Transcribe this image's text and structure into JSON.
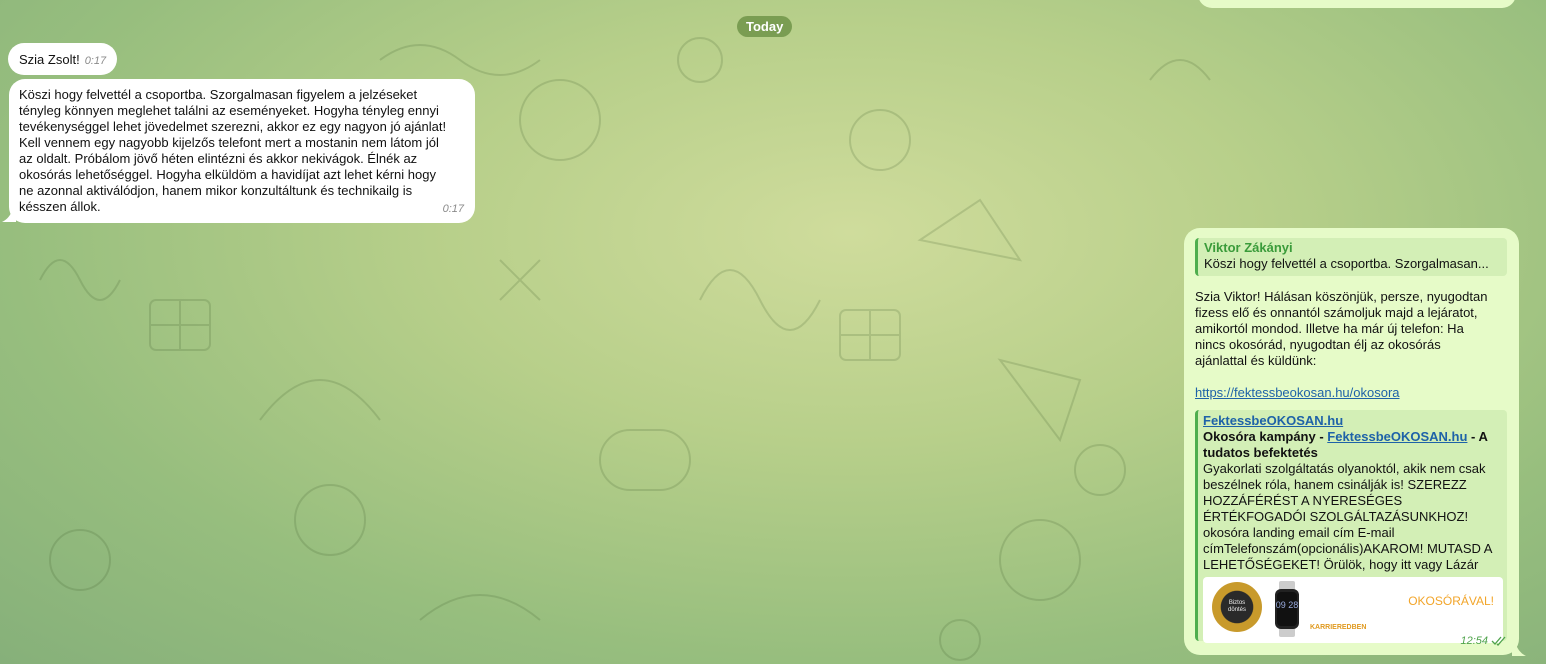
{
  "date_divider": "Today",
  "messages": {
    "greeting": {
      "text": "Szia Zsolt!",
      "time": "0:17"
    },
    "long_incoming": {
      "lines": [
        "Köszi hogy felvettél a csoportba. Szorgalmasan figyelem a jelzéseket",
        "tényleg könnyen meglehet találni  az eseményeket. Hogyha tényleg ennyi",
        "tevékenységgel lehet jövedelmet szerezni, akkor ez egy nagyon jó ajánlat!",
        "Kell vennem egy nagyobb kijelzős telefont mert a mostanin nem látom jól",
        "az oldalt. Próbálom jövő héten elintézni és akkor nekivágok. Élnék az",
        "okosórás lehetőséggel. Hogyha elküldöm a havidíjat azt lehet kérni hogy",
        "ne azonnal aktiválódjon, hanem mikor konzultáltunk és technikailg is",
        "késszen állok."
      ],
      "time": "0:17"
    },
    "outgoing": {
      "reply": {
        "author": "Viktor Zákányi",
        "snippet": "Köszi hogy felvettél a csoportba. Szorgalmasan..."
      },
      "body_lines": [
        "Szia Viktor! Hálásan köszönjük, persze, nyugodtan",
        "fizess elő és onnantól számoljuk majd a lejáratot,",
        "amikortól mondod. Illetve ha már új telefon: Ha",
        "nincs okosórád, nyugodtan élj az okosórás",
        "ajánlattal és küldünk:"
      ],
      "link": "https://fektessbeokosan.hu/okosora",
      "preview": {
        "site": "FektessbeOKOSAN.hu",
        "title_prefix": "Okosóra kampány - ",
        "title_link": "FektessbeOKOSAN.hu",
        "title_suffix": " - A tudatos befektetés",
        "description": "Gyakorlati szolgáltatás olyanoktól, akik nem csak beszélnek róla, hanem csinálják is! SZEREZZ HOZZÁFÉRÉST A NYERESÉGES ÉRTÉKFOGADÓI SZOLGÁLTAZÁSUNKHOZ! okosóra landing email cím E-mail címTelefonszám(opcionális)AKAROM! MUTASD A LEHETŐSÉGEKET! Örülök, hogy itt vagy Lázár Zsolt vagyok. Mondhatni egy átlago...",
        "image": {
          "badge_text": "Biztos döntés",
          "watch_time": "09 28",
          "promo_text": "OKOSÓRÁVAL!",
          "career_text": "KARRIEREDBEN"
        }
      },
      "time": "12:54"
    }
  },
  "colors": {
    "outgoing_bubble": "#e6fbc8",
    "accent_green": "#4fae4e",
    "link_blue": "#1e62a8"
  }
}
